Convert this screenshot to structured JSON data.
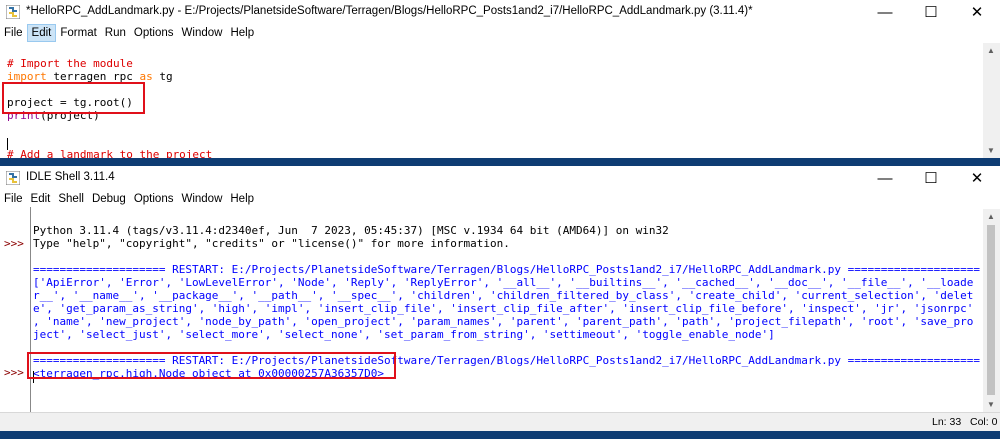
{
  "editor": {
    "title": "*HelloRPC_AddLandmark.py - E:/Projects/PlanetsideSoftware/Terragen/Blogs/HelloRPC_Posts1and2_i7/HelloRPC_AddLandmark.py (3.11.4)*",
    "menu": [
      "File",
      "Edit",
      "Format",
      "Run",
      "Options",
      "Window",
      "Help"
    ],
    "active_menu": "Edit",
    "lines": {
      "comment1": "# Import the module",
      "import_kw": "import",
      "import_mod": " terragen_rpc ",
      "as_kw": "as",
      "import_alias": " tg",
      "project_line": "project = tg.root()",
      "print_fn": "print",
      "print_args": "(project)",
      "comment2": "# Add a landmark to the project"
    }
  },
  "window_controls": {
    "minimize": "—",
    "maximize": "☐",
    "close": "✕"
  },
  "shell": {
    "title": "IDLE Shell 3.11.4",
    "menu": [
      "File",
      "Edit",
      "Shell",
      "Debug",
      "Options",
      "Window",
      "Help"
    ],
    "prompt": ">>>",
    "banner1": "Python 3.11.4 (tags/v3.11.4:d2340ef, Jun  7 2023, 05:45:37) [MSC v.1934 64 bit (AMD64)] on win32",
    "banner2": "Type \"help\", \"copyright\", \"credits\" or \"license()\" for more information.",
    "restart1": "==================== RESTART: E:/Projects/PlanetsideSoftware/Terragen/Blogs/HelloRPC_Posts1and2_i7/HelloRPC_AddLandmark.py ====================",
    "dir_output": [
      "['ApiError', 'Error', 'LowLevelError', 'Node', 'Reply', 'ReplyError', '__all__', '__builtins__', '__cached__', '__doc__', '__file__', '__loade",
      "r__', '__name__', '__package__', '__path__', '__spec__', 'children', 'children_filtered_by_class', 'create_child', 'current_selection', 'delet",
      "e', 'get_param_as_string', 'high', 'impl', 'insert_clip_file', 'insert_clip_file_after', 'insert_clip_file_before', 'inspect', 'jr', 'jsonrpc'",
      ", 'name', 'new_project', 'node_by_path', 'open_project', 'param_names', 'parent', 'parent_path', 'path', 'project_filepath', 'root', 'save_pro",
      "ject', 'select_just', 'select_more', 'select_none', 'set_param_from_string', 'settimeout', 'toggle_enable_node']"
    ],
    "restart2": "==================== RESTART: E:/Projects/PlanetsideSoftware/Terragen/Blogs/HelloRPC_Posts1and2_i7/HelloRPC_AddLandmark.py ====================",
    "node_output": "<terragen_rpc.high.Node object at 0x00000257A36357D0>",
    "status": {
      "line": "Ln: 33",
      "col": "Col: 0"
    }
  }
}
